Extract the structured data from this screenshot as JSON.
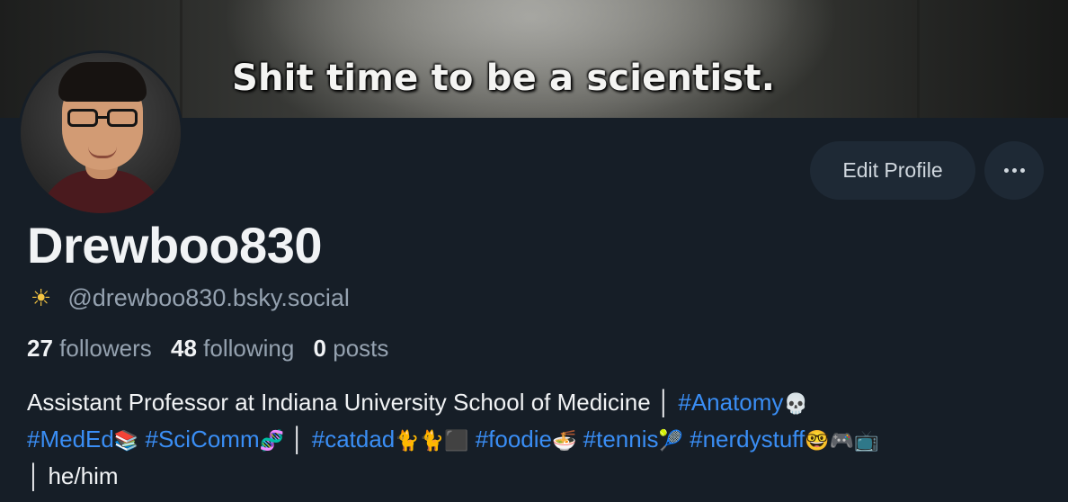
{
  "banner": {
    "caption": "Shit time to be a scientist."
  },
  "profile": {
    "display_name": "Drewboo830",
    "handle_emoji": "☀",
    "handle": "@drewboo830.bsky.social",
    "followers_count": "27",
    "followers_label": "followers",
    "following_count": "48",
    "following_label": "following",
    "posts_count": "0",
    "posts_label": "posts"
  },
  "actions": {
    "edit_profile_label": "Edit Profile",
    "more_icon": "ellipsis-icon"
  },
  "bio": {
    "line1_text": "Assistant Professor at Indiana University School of Medicine │ ",
    "tag_anatomy": "#Anatomy",
    "emoji_skull": "💀",
    "tag_meded": "#MedEd",
    "emoji_books": "📚",
    "tag_scicomm": "#SciComm",
    "emoji_dna": "🧬",
    "sep1": " │ ",
    "tag_catdad": "#catdad",
    "emoji_cats": "🐈🐈⬛",
    "tag_foodie": "#foodie",
    "emoji_noodles": "🍜",
    "tag_tennis": "#tennis",
    "emoji_tennis": "🎾",
    "tag_nerdystuff": "#nerdystuff",
    "emoji_nerd": "🤓🎮📺",
    "tail": "│ he/him"
  },
  "colors": {
    "background": "#161e27",
    "link": "#3a8ef5",
    "muted": "#95a2b0",
    "button_bg": "#1e2935"
  }
}
